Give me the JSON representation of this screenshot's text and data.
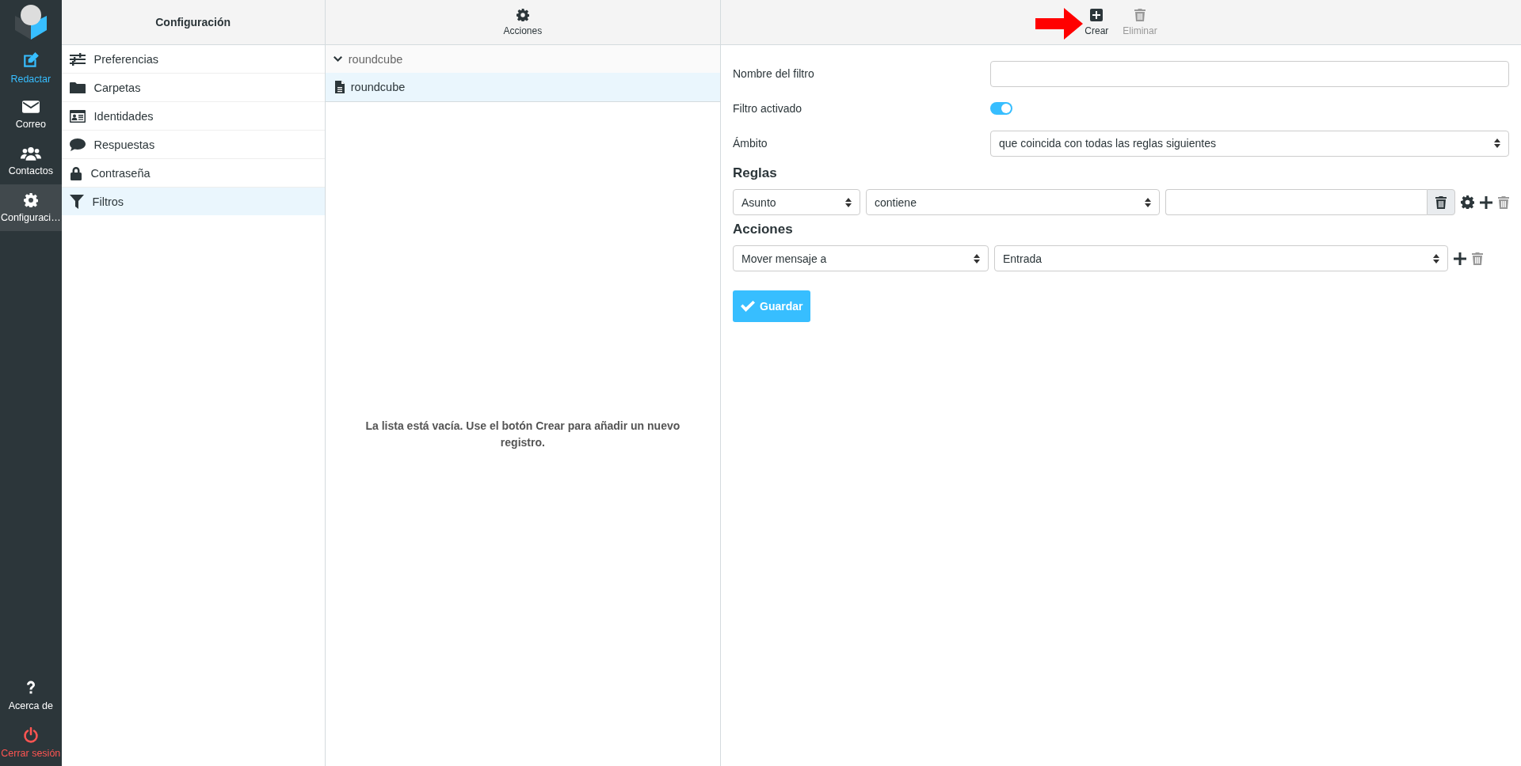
{
  "nav": {
    "items": [
      {
        "label": "Redactar",
        "kind": "accent",
        "selected": false
      },
      {
        "label": "Correo",
        "kind": "plain",
        "selected": false
      },
      {
        "label": "Contactos",
        "kind": "plain",
        "selected": false
      },
      {
        "label": "Configuraci…",
        "kind": "plain",
        "selected": true
      }
    ],
    "bottom": [
      {
        "label": "Acerca de",
        "kind": "plain"
      },
      {
        "label": "Cerrar sesión",
        "kind": "danger"
      }
    ]
  },
  "settings": {
    "title": "Configuración",
    "items": [
      {
        "label": "Preferencias",
        "selected": false
      },
      {
        "label": "Carpetas",
        "selected": false
      },
      {
        "label": "Identidades",
        "selected": false
      },
      {
        "label": "Respuestas",
        "selected": false
      },
      {
        "label": "Contraseña",
        "selected": false
      },
      {
        "label": "Filtros",
        "selected": true
      }
    ]
  },
  "filter_sets": {
    "toolbar": {
      "label": "Acciones"
    },
    "group": {
      "label": "roundcube",
      "expanded": true
    },
    "items": [
      {
        "label": "roundcube",
        "selected": true
      }
    ]
  },
  "filters": {
    "empty_message": "La lista está vacía. Use el botón Crear para añadir un nuevo registro."
  },
  "toolbar": {
    "buttons": [
      {
        "label": "Crear",
        "disabled": false
      },
      {
        "label": "Eliminar",
        "disabled": true
      }
    ]
  },
  "form": {
    "name": {
      "label": "Nombre del filtro"
    },
    "enabled": {
      "label": "Filtro activado",
      "on": true
    },
    "scope": {
      "label": "Ámbito",
      "value": "que coincida con todas las reglas siguientes"
    },
    "rules_heading": "Reglas",
    "rule": {
      "header": "Asunto",
      "operator": "contiene"
    },
    "actions_heading": "Acciones",
    "action": {
      "type": "Mover mensaje a",
      "target": "Entrada"
    },
    "save": "Guardar"
  }
}
